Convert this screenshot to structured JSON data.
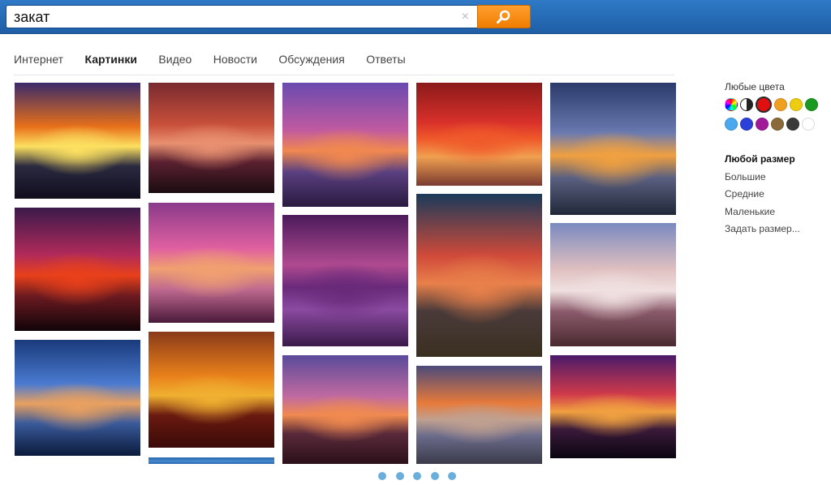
{
  "search": {
    "query": "закат"
  },
  "icons": {
    "clear": "×",
    "search": "search-icon"
  },
  "tabs": [
    {
      "label": "Интернет",
      "active": false
    },
    {
      "label": "Картинки",
      "active": true
    },
    {
      "label": "Видео",
      "active": false
    },
    {
      "label": "Новости",
      "active": false
    },
    {
      "label": "Обсуждения",
      "active": false
    },
    {
      "label": "Ответы",
      "active": false
    }
  ],
  "sidebar": {
    "colors_title": "Любые цвета",
    "colors": [
      {
        "name": "multicolor",
        "value": "conic"
      },
      {
        "name": "black-white",
        "value": "bw"
      },
      {
        "name": "red",
        "value": "#e01010",
        "selected": true
      },
      {
        "name": "orange",
        "value": "#f0a020"
      },
      {
        "name": "yellow",
        "value": "#eecc10"
      },
      {
        "name": "green",
        "value": "#1a9a20"
      },
      {
        "name": "light-blue",
        "value": "#4aa8ee"
      },
      {
        "name": "blue",
        "value": "#2c3fd8"
      },
      {
        "name": "purple",
        "value": "#a01a9a"
      },
      {
        "name": "brown",
        "value": "#8a6a3a"
      },
      {
        "name": "dark-gray",
        "value": "#3a3a3a"
      },
      {
        "name": "white",
        "value": "#ffffff"
      }
    ],
    "sizes": [
      {
        "label": "Любой размер",
        "active": true
      },
      {
        "label": "Большие",
        "active": false
      },
      {
        "label": "Средние",
        "active": false
      },
      {
        "label": "Маленькие",
        "active": false
      },
      {
        "label": "Задать размер...",
        "active": false
      }
    ]
  },
  "images": [
    {
      "name": "sunset-sea-clouds",
      "colors": [
        "#3a2a6a",
        "#e8701a",
        "#fce060",
        "#2a2a40",
        "#100c1c"
      ]
    },
    {
      "name": "sunset-people-beach",
      "colors": [
        "#7a2a30",
        "#c8503a",
        "#e89070",
        "#5a2030",
        "#1a0c10"
      ]
    },
    {
      "name": "sunset-seagulls-purple",
      "colors": [
        "#6a4ab0",
        "#c05aa0",
        "#f08850",
        "#5a4080",
        "#2a1a40"
      ]
    },
    {
      "name": "sunset-red-sky-sea",
      "colors": [
        "#8a1a1a",
        "#d8302a",
        "#f05a2a",
        "#f0a050",
        "#7a3a30"
      ]
    },
    {
      "name": "sunset-blue-waves",
      "colors": [
        "#2a3a6a",
        "#6a7ab0",
        "#f0a040",
        "#5a6080",
        "#202838"
      ]
    },
    {
      "name": "sunset-red-sun-clouds",
      "colors": [
        "#3a1a4a",
        "#b02a5a",
        "#e8401a",
        "#6a1a20",
        "#100408"
      ]
    },
    {
      "name": "sunset-pink-boats",
      "colors": [
        "#8a3a8a",
        "#e060a0",
        "#f0a070",
        "#c06a90",
        "#4a1a3a"
      ]
    },
    {
      "name": "sunset-city-skyline",
      "colors": [
        "#4a1a5a",
        "#b04a90",
        "#6a2a7a",
        "#8a4aa0",
        "#3a1a4a"
      ]
    },
    {
      "name": "sunset-dramatic-clouds-lake",
      "colors": [
        "#1a3a5a",
        "#d04a3a",
        "#e8804a",
        "#4a3a3a",
        "#3a3020"
      ]
    },
    {
      "name": "sunset-blue-dusk",
      "colors": [
        "#1a3a7a",
        "#4a7ad0",
        "#e8a060",
        "#3a5a9a",
        "#0a1a3a"
      ]
    },
    {
      "name": "sunset-orange-horizon",
      "colors": [
        "#8a3a1a",
        "#e8801a",
        "#f0b030",
        "#6a1a10",
        "#3a0a08"
      ]
    },
    {
      "name": "sunset-pier",
      "colors": [
        "#5a4a9a",
        "#c06aa0",
        "#f08a50",
        "#5a2a3a",
        "#2a1018"
      ]
    },
    {
      "name": "sunset-city-buildings",
      "colors": [
        "#4a4a7a",
        "#e87a3a",
        "#c0a090",
        "#6a6a8a",
        "#3a3a4a"
      ]
    },
    {
      "name": "sunset-winter-tree",
      "colors": [
        "#7a8ac0",
        "#e0c0c0",
        "#f0e0e0",
        "#8a5a6a",
        "#4a2a30"
      ]
    },
    {
      "name": "sunset-purple-burst",
      "colors": [
        "#4a1a6a",
        "#d03a4a",
        "#f0a040",
        "#3a1a3a",
        "#0a0410"
      ]
    },
    {
      "name": "sunset-bottom-peek",
      "colors": [
        "#2a6ab0",
        "#3a7ac0",
        "#4a8ad0",
        "#3a7ac0",
        "#2a6ab0"
      ]
    }
  ],
  "pager": {
    "count": 5
  }
}
